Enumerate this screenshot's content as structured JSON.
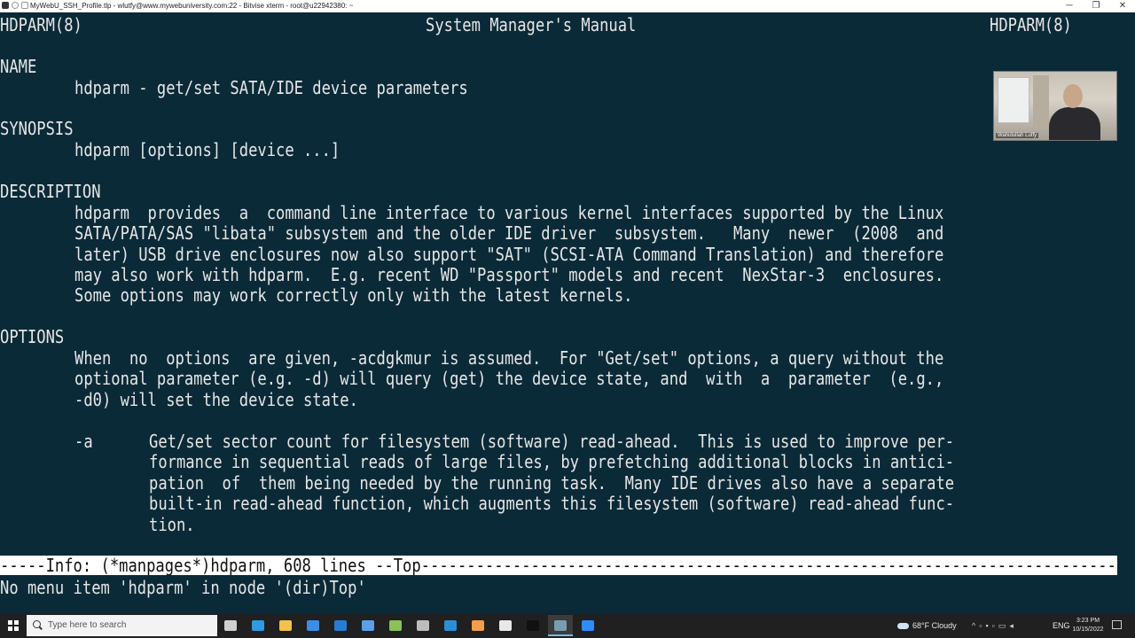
{
  "window": {
    "title": "MyWebU_SSH_Profile.tlp - wlutfy@www.mywebuniversity.com:22 - Bitvise xterm - root@u22942380: ~",
    "minimize": "─",
    "maximize": "❐",
    "close": "✕"
  },
  "man": {
    "header_left": "HDPARM(8)",
    "header_center": "System Manager's Manual",
    "header_right": "HDPARM(8)",
    "name_heading": "NAME",
    "name_text": "hdparm - get/set SATA/IDE device parameters",
    "synopsis_heading": "SYNOPSIS",
    "synopsis_text": "hdparm [options] [device ...]",
    "description_heading": "DESCRIPTION",
    "description_lines": [
      "hdparm  provides  a  command line interface to various kernel interfaces supported by the Linux",
      "SATA/PATA/SAS \"libata\" subsystem and the older IDE driver  subsystem.   Many  newer  (2008  and",
      "later) USB drive enclosures now also support \"SAT\" (SCSI-ATA Command Translation) and therefore",
      "may also work with hdparm.  E.g. recent WD \"Passport\" models and recent  NexStar-3  enclosures.",
      "Some options may work correctly only with the latest kernels."
    ],
    "options_heading": "OPTIONS",
    "options_lines": [
      "When  no  options  are given, -acdgkmur is assumed.  For \"Get/set\" options, a query without the",
      "optional parameter (e.g. -d) will query (get) the device state, and  with  a  parameter  (e.g.,",
      "-d0) will set the device state."
    ],
    "option_a_flag": "-a",
    "option_a_lines": [
      "Get/set sector count for filesystem (software) read-ahead.  This is used to improve per-",
      "formance in sequential reads of large files, by prefetching additional blocks in antici-",
      "pation  of  them being needed by the running task.  Many IDE drives also have a separate",
      "built-in read-ahead function, which augments this filesystem (software) read-ahead func-",
      "tion."
    ]
  },
  "modeline": {
    "text": "-----Info: (*manpages*)hdparm, 608 lines --Top--------------------------------------------------------------------------------------------"
  },
  "echo_area": {
    "text": "No menu item 'hdparm' in node '(dir)Top'"
  },
  "webcam": {
    "name": "Wahidullah Lutfy"
  },
  "taskbar": {
    "search_placeholder": "Type here to search",
    "weather": "68°F  Cloudy",
    "language": "ENG",
    "time": "3:23 PM",
    "date": "10/15/2022",
    "pinned": [
      {
        "name": "task-view-icon",
        "color": "#d0d0d0"
      },
      {
        "name": "edge-icon",
        "color": "#2f9be0"
      },
      {
        "name": "file-explorer-icon",
        "color": "#f2c14e"
      },
      {
        "name": "store-icon",
        "color": "#3a8ee6"
      },
      {
        "name": "mail-icon",
        "color": "#2a7bd4"
      },
      {
        "name": "network-icon",
        "color": "#5aa0e8"
      },
      {
        "name": "notepadplus-icon",
        "color": "#8ac15a"
      },
      {
        "name": "cube-icon",
        "color": "#bdbdbd"
      },
      {
        "name": "vscode-icon",
        "color": "#2c8fd6"
      },
      {
        "name": "document-icon",
        "color": "#f0a04b"
      },
      {
        "name": "notepad-icon",
        "color": "#e8e8e8"
      },
      {
        "name": "terminal-icon",
        "color": "#111111"
      },
      {
        "name": "bitvise-icon",
        "color": "#7a9cb0"
      },
      {
        "name": "zoom-icon",
        "color": "#2d8cff"
      }
    ]
  }
}
